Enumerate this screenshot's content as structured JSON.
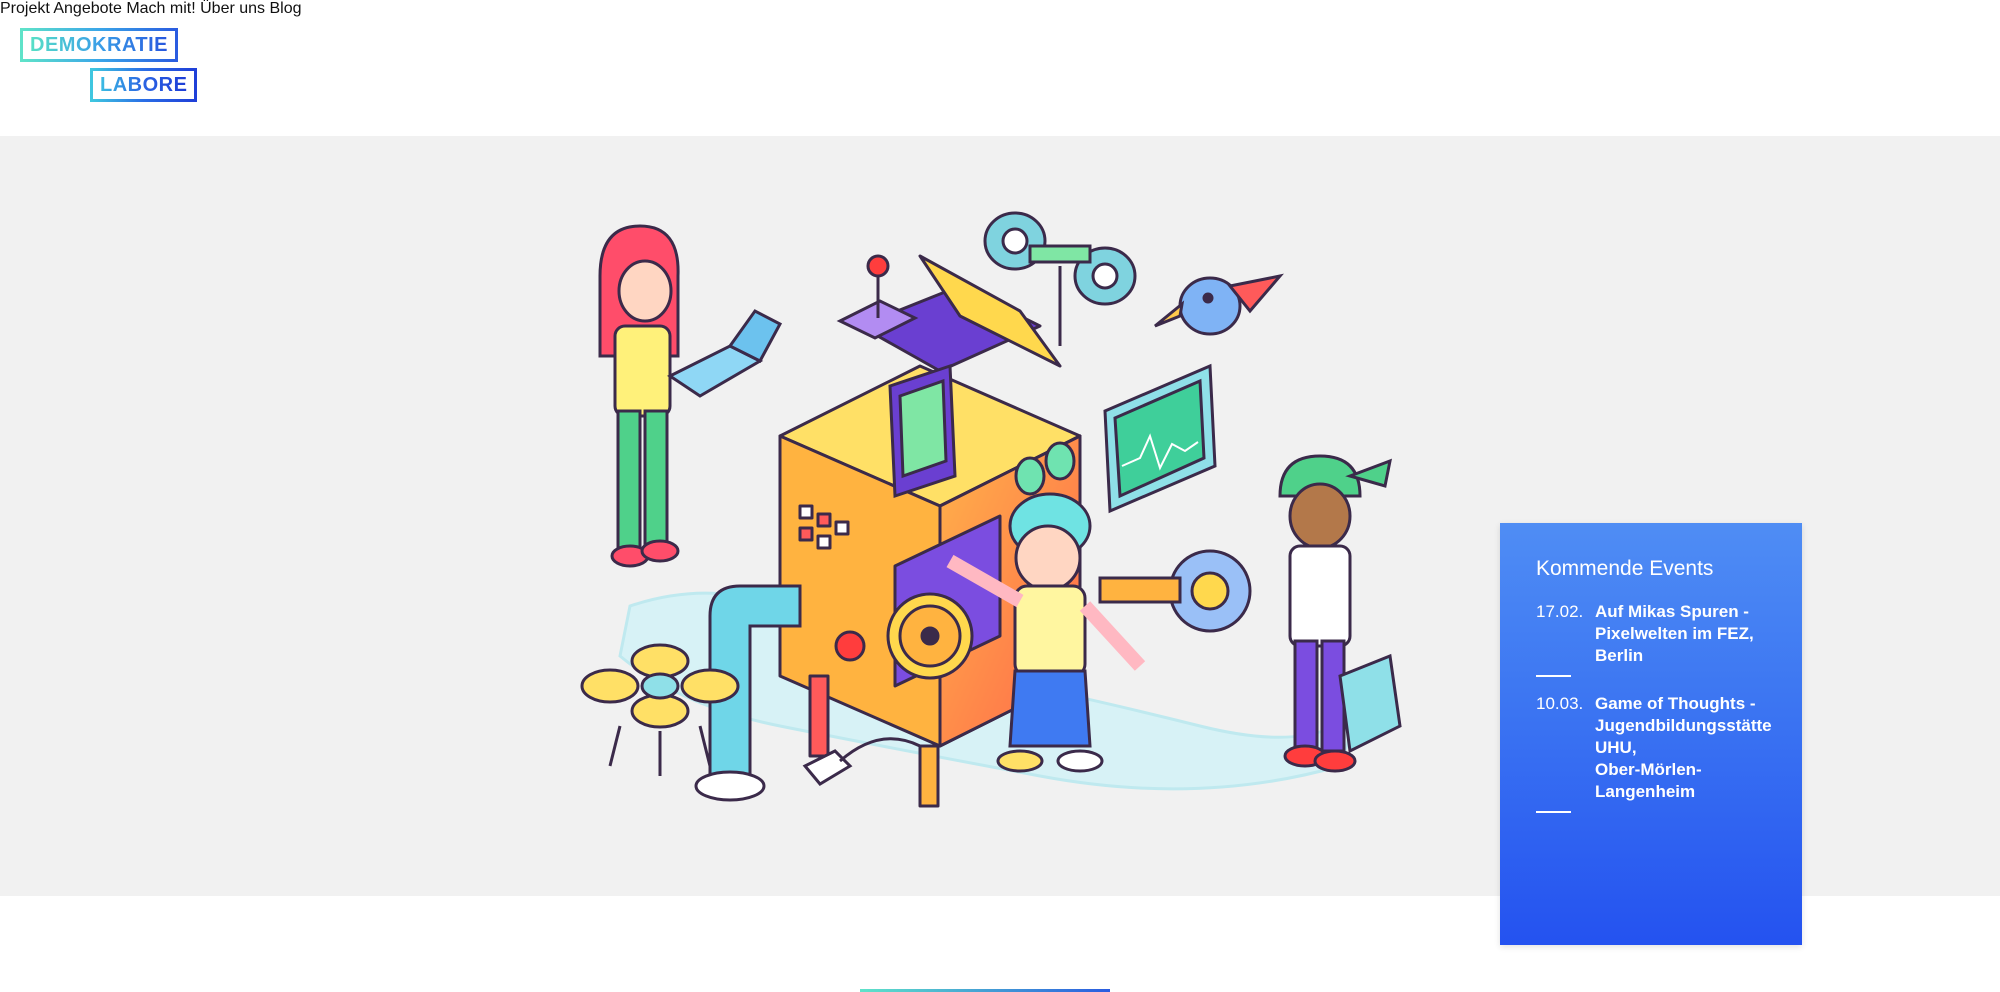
{
  "logo": {
    "line1": "DEMOKRATIE",
    "line2": "LABORE"
  },
  "nav": {
    "items": [
      {
        "label": "Projekt"
      },
      {
        "label": "Angebote"
      },
      {
        "label": "Mach mit!"
      },
      {
        "label": "Über uns"
      },
      {
        "label": "Blog"
      }
    ]
  },
  "events": {
    "title": "Kommende Events",
    "items": [
      {
        "date": "17.02.",
        "name": "Auf Mikas Spuren -\nPixelwelten im FEZ,\nBerlin"
      },
      {
        "date": "10.03.",
        "name": "Game of Thoughts -\nJugendbildungsstätte\nUHU,\nOber-Mörlen-\nLangenheim"
      }
    ]
  },
  "colors": {
    "accent_blue": "#2f63f1",
    "hero_background": "#f1f1f1",
    "logo_gradient_start": "#5fe3c9",
    "logo_gradient_end": "#2a5ce0"
  }
}
